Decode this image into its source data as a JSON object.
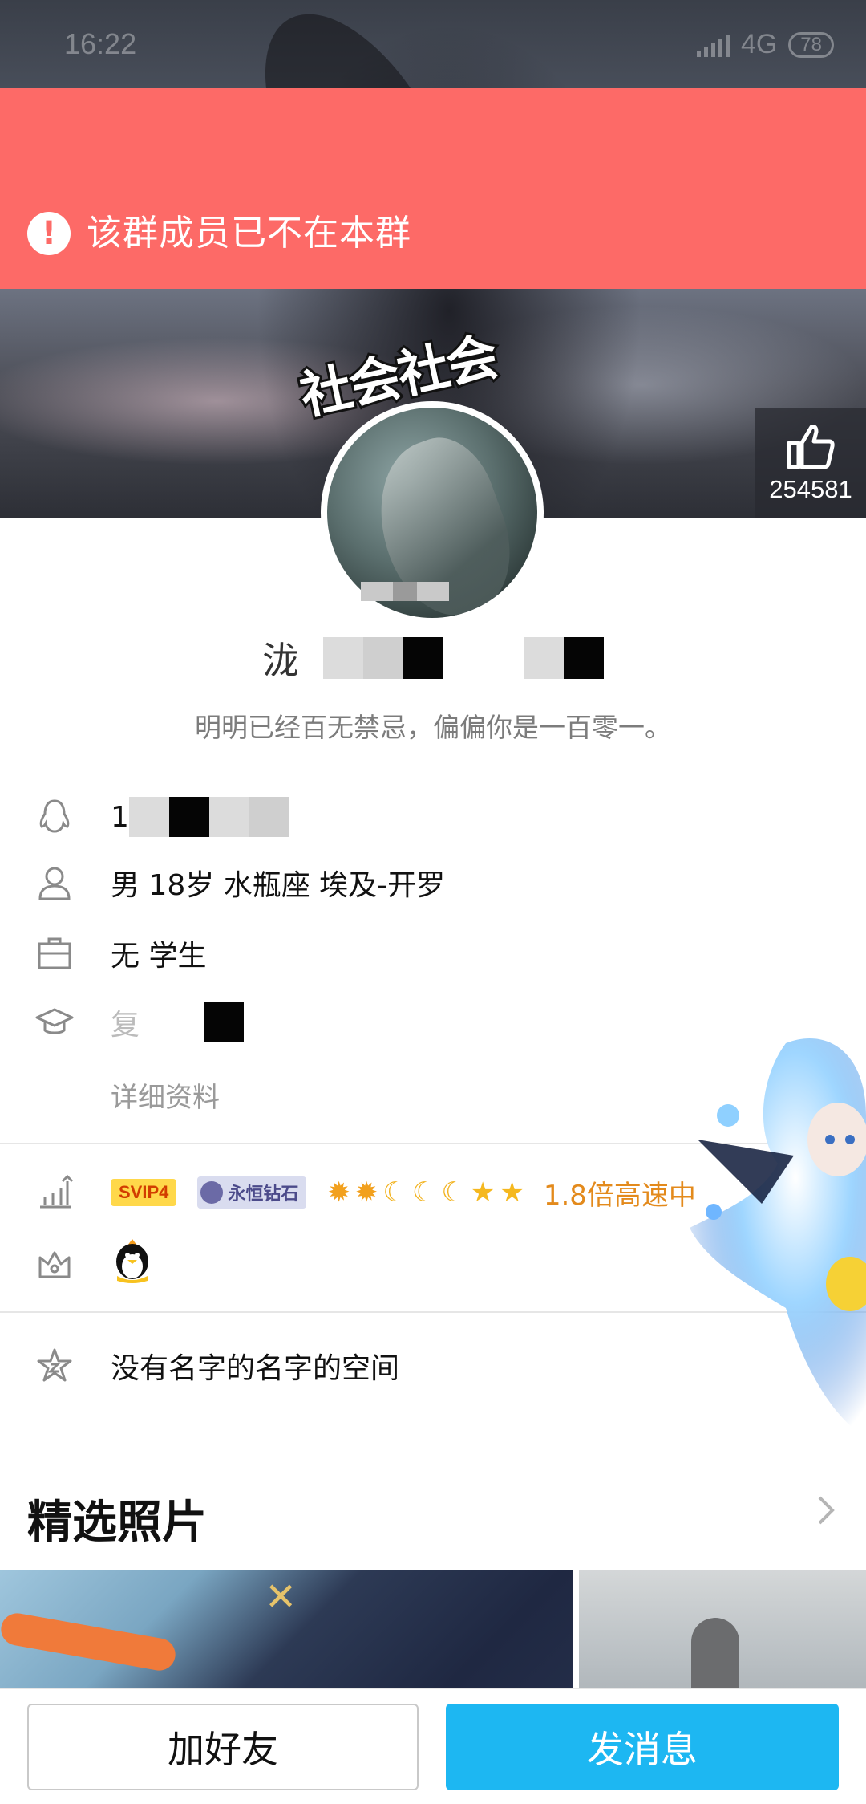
{
  "status_bar": {
    "time": "16:22",
    "network": "4G",
    "battery": "78"
  },
  "alert": {
    "text": "该群成员已不在本群",
    "icon": "exclamation-icon"
  },
  "cover": {
    "badge_text": "社会社会",
    "like": {
      "icon": "thumbs-up-icon",
      "count": "254581"
    }
  },
  "profile": {
    "nickname_visible_char": "泷",
    "signature": "明明已经百无禁忌，偏偏你是一百零一。",
    "qq_prefix": "1",
    "basic_info": "男  18岁  水瓶座  埃及-开罗",
    "job": "无 学生",
    "school_prefix": "复",
    "detail_link": "详细资料"
  },
  "levels": {
    "vip_tag": "SVIP4",
    "diamond_tag": "永恒钻石",
    "speed_text": "1.8倍高速中"
  },
  "space": {
    "label": "没有名字的名字的空间"
  },
  "featured": {
    "title": "精选照片"
  },
  "actions": {
    "add_friend": "加好友",
    "send_message": "发消息"
  },
  "colors": {
    "alert_bg": "#fd6a67",
    "primary_button": "#1db7f2",
    "speed_text": "#e38a1c"
  }
}
